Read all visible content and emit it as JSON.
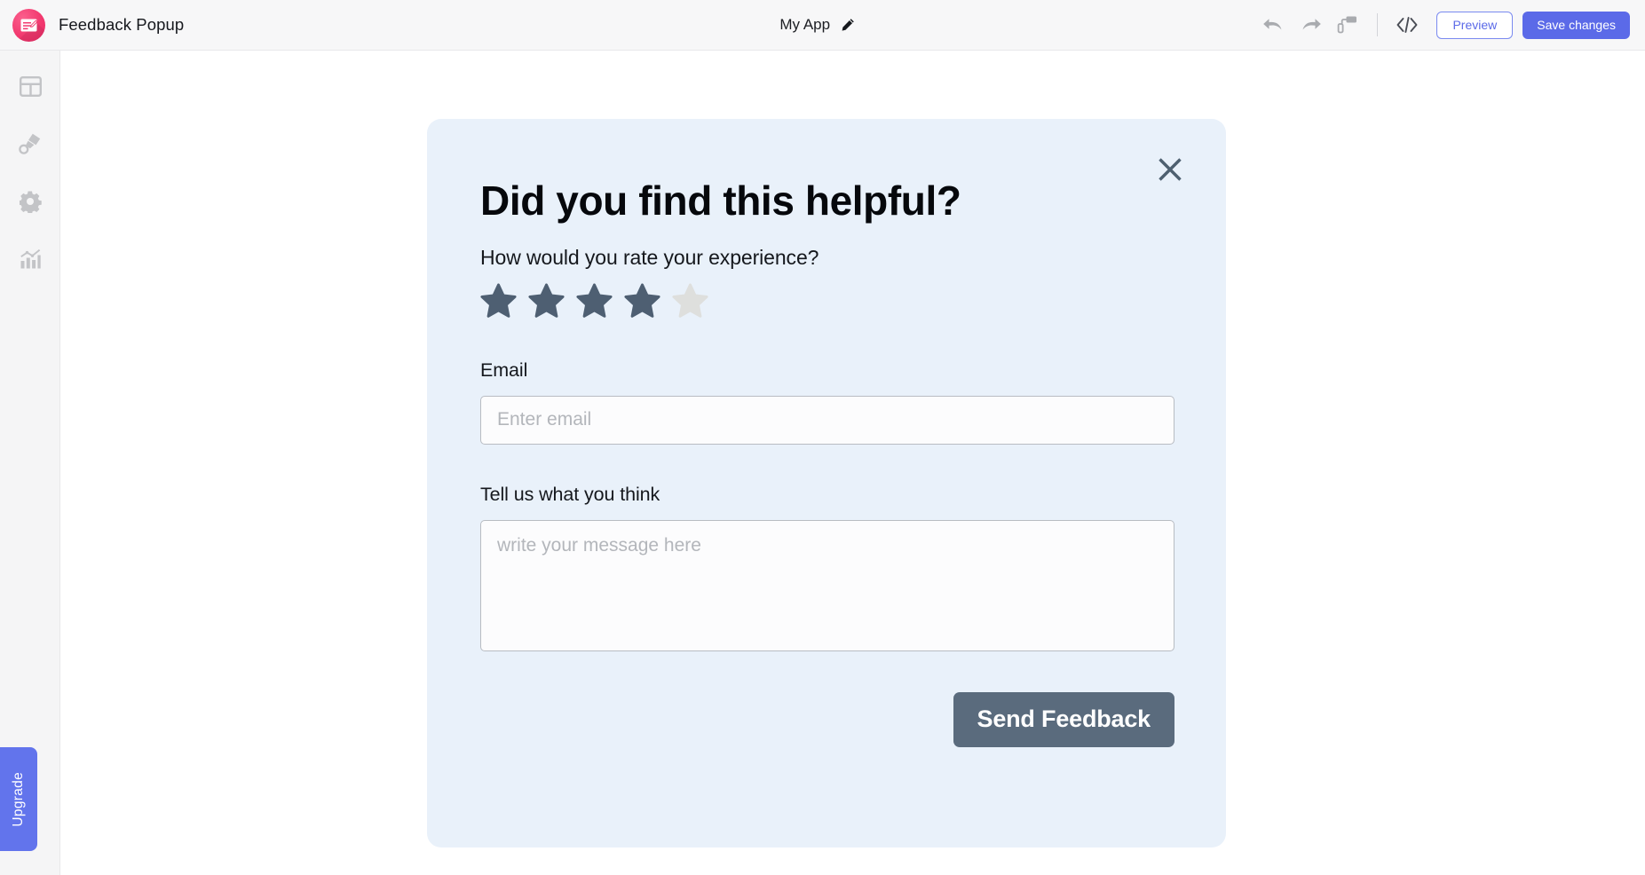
{
  "topbar": {
    "logo_icon": "feedback-form-icon",
    "brand_title": "Feedback Popup",
    "app_name": "My App",
    "edit_icon": "pencil-icon",
    "tools": [
      {
        "icon": "undo-icon",
        "name": "undo-button"
      },
      {
        "icon": "redo-icon",
        "name": "redo-button"
      },
      {
        "icon": "paint-roller-icon",
        "name": "style-button"
      }
    ],
    "code_icon": "code-brackets-icon",
    "preview_label": "Preview",
    "save_label": "Save changes",
    "accent_color": "#5b6ae8",
    "brand_color": "#f2396f"
  },
  "sidebar": {
    "items": [
      {
        "icon": "layout-grid-icon",
        "name": "sidebar-item-layout"
      },
      {
        "icon": "paint-brush-icon",
        "name": "sidebar-item-design"
      },
      {
        "icon": "gear-icon",
        "name": "sidebar-item-settings"
      },
      {
        "icon": "analytics-chart-icon",
        "name": "sidebar-item-analytics"
      }
    ],
    "upgrade_label": "Upgrade",
    "upgrade_color": "#6274ec"
  },
  "popup": {
    "close_icon": "close-x-icon",
    "heading": "Did you find this helpful?",
    "subheading": "How would you rate your experience?",
    "rating": {
      "value": 4,
      "max": 5,
      "filled_color": "#4e5f72",
      "empty_color": "#dedfdd"
    },
    "email_label": "Email",
    "email_value": "",
    "email_placeholder": "Enter email",
    "message_label": "Tell us what you think",
    "message_value": "",
    "message_placeholder": "write your message here",
    "submit_label": "Send Feedback",
    "submit_color": "#5a6b7d",
    "card_color": "#e9f1fa"
  }
}
